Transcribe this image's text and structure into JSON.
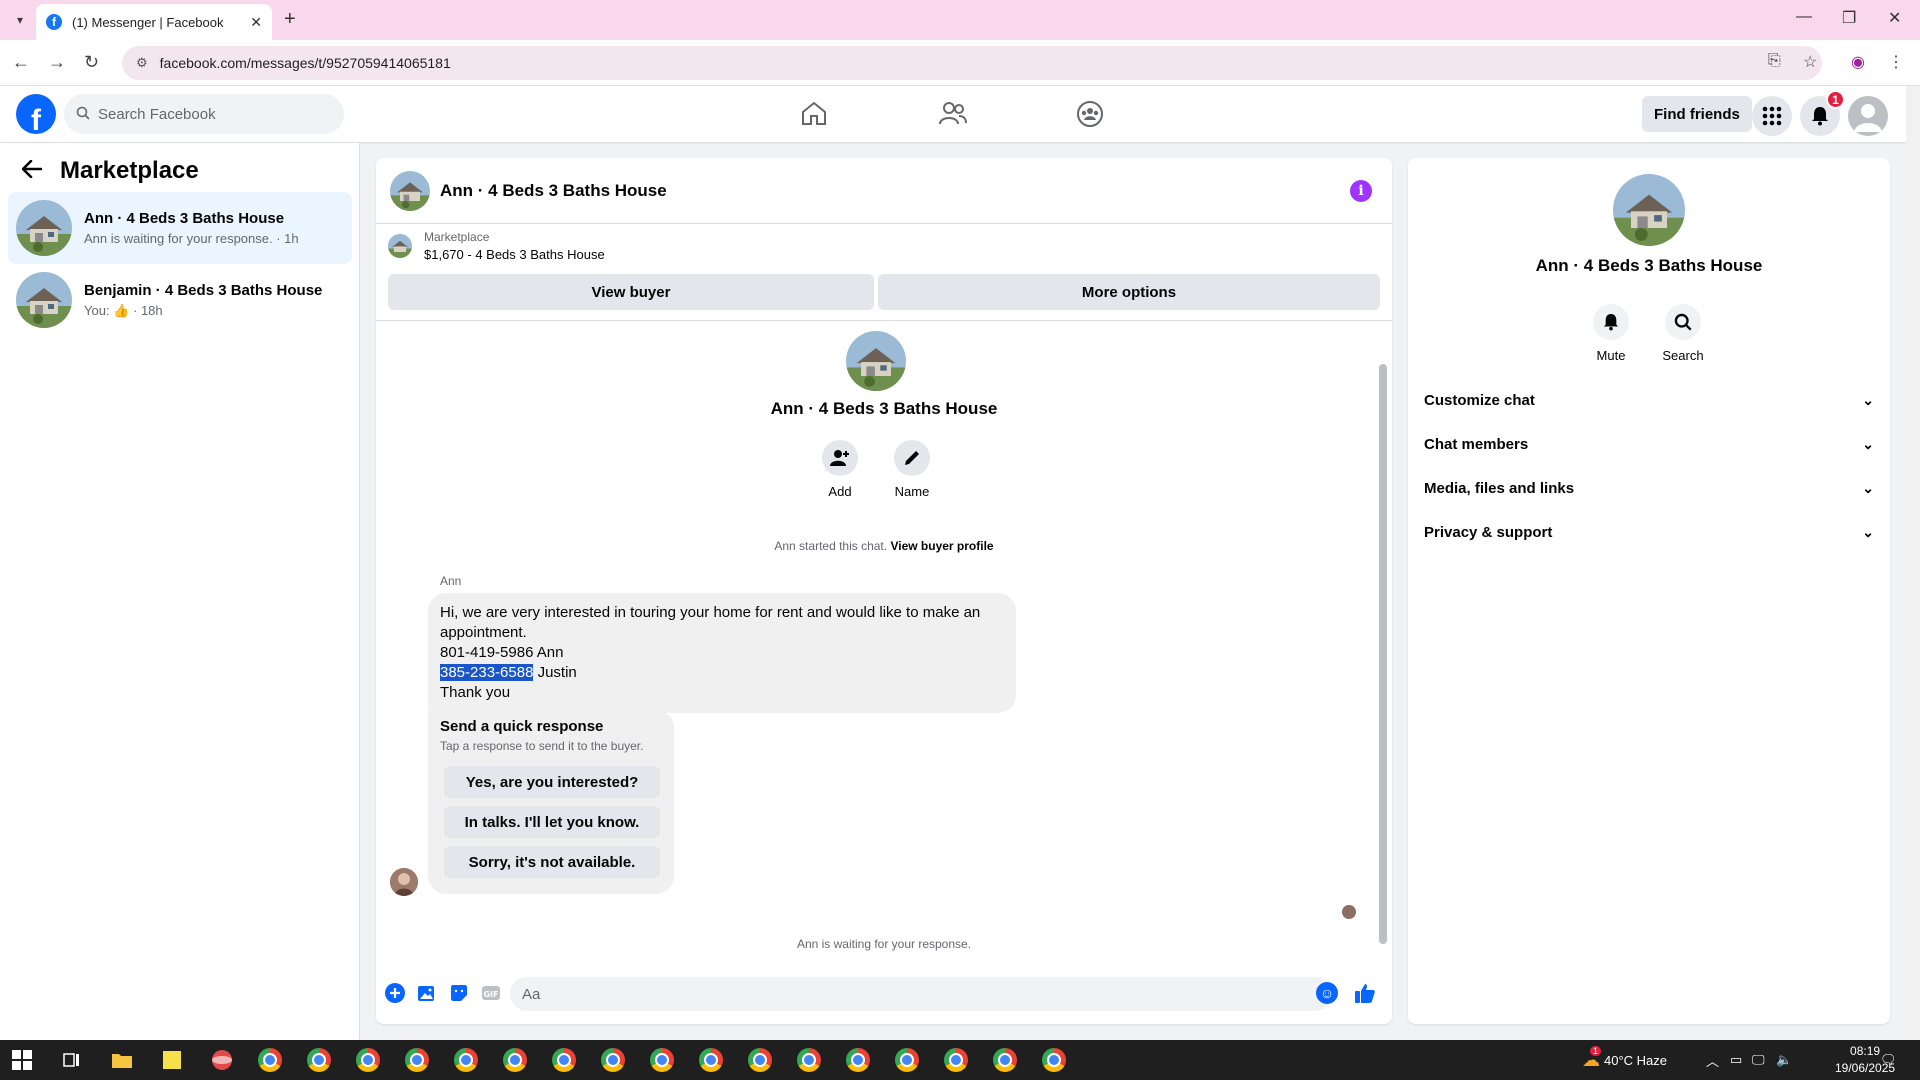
{
  "browser": {
    "tab_title": "(1) Messenger | Facebook",
    "url": "facebook.com/messages/t/9527059414065181"
  },
  "fb_header": {
    "search_placeholder": "Search Facebook",
    "find_friends_label": "Find friends",
    "notification_count": "1"
  },
  "sidebar": {
    "title": "Marketplace",
    "conversations": [
      {
        "name": "Ann · 4 Beds 3 Baths House",
        "preview": "Ann is waiting for your response. · 1h",
        "active": true
      },
      {
        "name": "Benjamin · 4 Beds 3 Baths House",
        "preview_prefix": "You:",
        "preview_suffix": "· 18h",
        "active": false
      }
    ]
  },
  "chat": {
    "title": "Ann · 4 Beds 3 Baths House",
    "listing_label": "Marketplace",
    "listing_price": "$1,670 - 4 Beds 3 Baths House",
    "view_buyer_label": "View buyer",
    "more_options_label": "More options",
    "center_name": "Ann · 4 Beds 3 Baths House",
    "add_label": "Add",
    "name_label": "Name",
    "started_text": "Ann started this chat.",
    "view_profile_label": "View buyer profile",
    "sender": "Ann",
    "message_lines": [
      "Hi, we are very interested in touring your home for rent and would like to make an",
      "appointment.",
      "801-419-5986 Ann"
    ],
    "highlighted_phone": "385-233-6588",
    "phone_suffix": " Justin",
    "message_last": "Thank you",
    "quick_title": "Send a quick response",
    "quick_subtitle": "Tap a response to send it to the buyer.",
    "quick_responses": [
      "Yes, are you interested?",
      "In talks. I'll let you know.",
      "Sorry, it's not available."
    ],
    "waiting_text": "Ann is waiting for your response.",
    "composer_placeholder": "Aa"
  },
  "details_panel": {
    "name": "Ann · 4 Beds 3 Baths House",
    "mute_label": "Mute",
    "search_label": "Search",
    "sections": [
      "Customize chat",
      "Chat members",
      "Media, files and links",
      "Privacy & support"
    ]
  },
  "taskbar": {
    "weather": "40°C  Haze",
    "weather_badge": "1",
    "time": "08:19",
    "date": "19/06/2025"
  },
  "colors": {
    "fb_blue": "#0866ff",
    "tab_bar": "#f9d7ec",
    "info_purple": "#a033ff",
    "selection": "#1a56c9"
  }
}
